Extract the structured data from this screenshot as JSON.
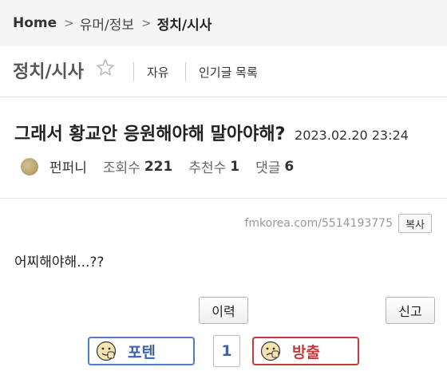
{
  "breadcrumb": {
    "home": "Home",
    "section": "유머/정보",
    "current": "정치/시사"
  },
  "board": {
    "title": "정치/시사",
    "links": [
      "자유",
      "인기글 목록"
    ]
  },
  "post": {
    "title": "그래서 황교안 응원해야해 말아야해?",
    "date": "2023.02.20 23:24",
    "author": "펀퍼니",
    "views_label": "조회수",
    "views": "221",
    "recommends_label": "추천수",
    "recommends": "1",
    "comments_label": "댓글",
    "comments": "6",
    "permalink": "fmkorea.com/5514193775",
    "copy_label": "복사",
    "body": "어찌해야해...??"
  },
  "actions": {
    "history_label": "이력",
    "report_label": "신고"
  },
  "vote": {
    "up_label": "포텐",
    "count": "1",
    "down_label": "방출"
  },
  "icons": {
    "star": "star-icon",
    "vote_up": "thumbs-up-face-icon",
    "vote_down": "thumbs-down-face-icon"
  },
  "colors": {
    "vote_up": "#3a62b0",
    "vote_down": "#c23a3a"
  }
}
